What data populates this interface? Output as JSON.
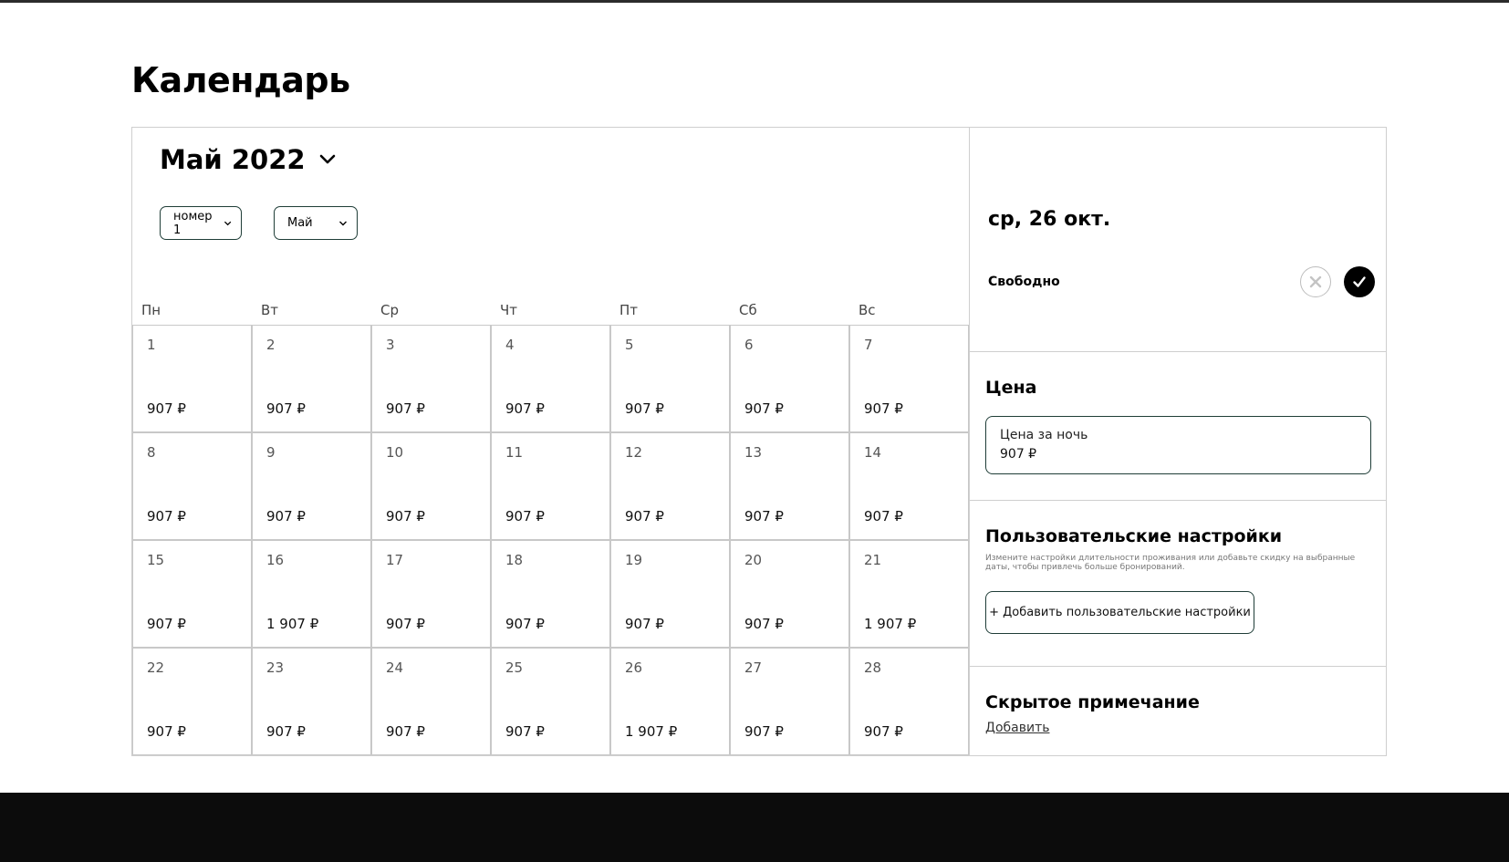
{
  "page": {
    "title": "Календарь"
  },
  "calendar": {
    "month_title": "Май 2022",
    "room_select": "номер 1",
    "month_select": "Май",
    "weekdays": [
      "Пн",
      "Вт",
      "Ср",
      "Чт",
      "Пт",
      "Сб",
      "Вс"
    ],
    "weeks": [
      [
        {
          "day": "1",
          "price": "907 ₽"
        },
        {
          "day": "2",
          "price": "907 ₽"
        },
        {
          "day": "3",
          "price": "907 ₽"
        },
        {
          "day": "4",
          "price": "907 ₽"
        },
        {
          "day": "5",
          "price": "907 ₽"
        },
        {
          "day": "6",
          "price": "907 ₽"
        },
        {
          "day": "7",
          "price": "907 ₽"
        }
      ],
      [
        {
          "day": "8",
          "price": "907 ₽"
        },
        {
          "day": "9",
          "price": "907 ₽"
        },
        {
          "day": "10",
          "price": "907 ₽"
        },
        {
          "day": "11",
          "price": "907 ₽"
        },
        {
          "day": "12",
          "price": "907 ₽"
        },
        {
          "day": "13",
          "price": "907 ₽"
        },
        {
          "day": "14",
          "price": "907 ₽"
        }
      ],
      [
        {
          "day": "15",
          "price": "907 ₽"
        },
        {
          "day": "16",
          "price": "1 907 ₽"
        },
        {
          "day": "17",
          "price": "907 ₽"
        },
        {
          "day": "18",
          "price": "907 ₽"
        },
        {
          "day": "19",
          "price": "907 ₽"
        },
        {
          "day": "20",
          "price": "907 ₽"
        },
        {
          "day": "21",
          "price": "1 907 ₽"
        }
      ],
      [
        {
          "day": "22",
          "price": "907 ₽"
        },
        {
          "day": "23",
          "price": "907 ₽"
        },
        {
          "day": "24",
          "price": "907 ₽"
        },
        {
          "day": "25",
          "price": "907 ₽"
        },
        {
          "day": "26",
          "price": "1 907 ₽"
        },
        {
          "day": "27",
          "price": "907 ₽"
        },
        {
          "day": "28",
          "price": "907 ₽"
        }
      ]
    ]
  },
  "side": {
    "date_title": "ср, 26 окт.",
    "status_label": "Свободно",
    "price_section": {
      "title": "Цена",
      "field_label": "Цена за ночь",
      "field_value": "907 ₽"
    },
    "custom_section": {
      "title": "Пользовательские настройки",
      "hint": "Измените настройки длительности проживания или добавьте скидку на выбранные даты, чтобы привлечь больше бронирований.",
      "add_button": "+ Добавить пользовательские настройки"
    },
    "note_section": {
      "title": "Скрытое примечание",
      "add_link": "Добавить"
    }
  },
  "colors": {
    "accent_border": "#1f3d37",
    "footer": "#0c0c0c",
    "cell_border": "#c8c8c8"
  }
}
